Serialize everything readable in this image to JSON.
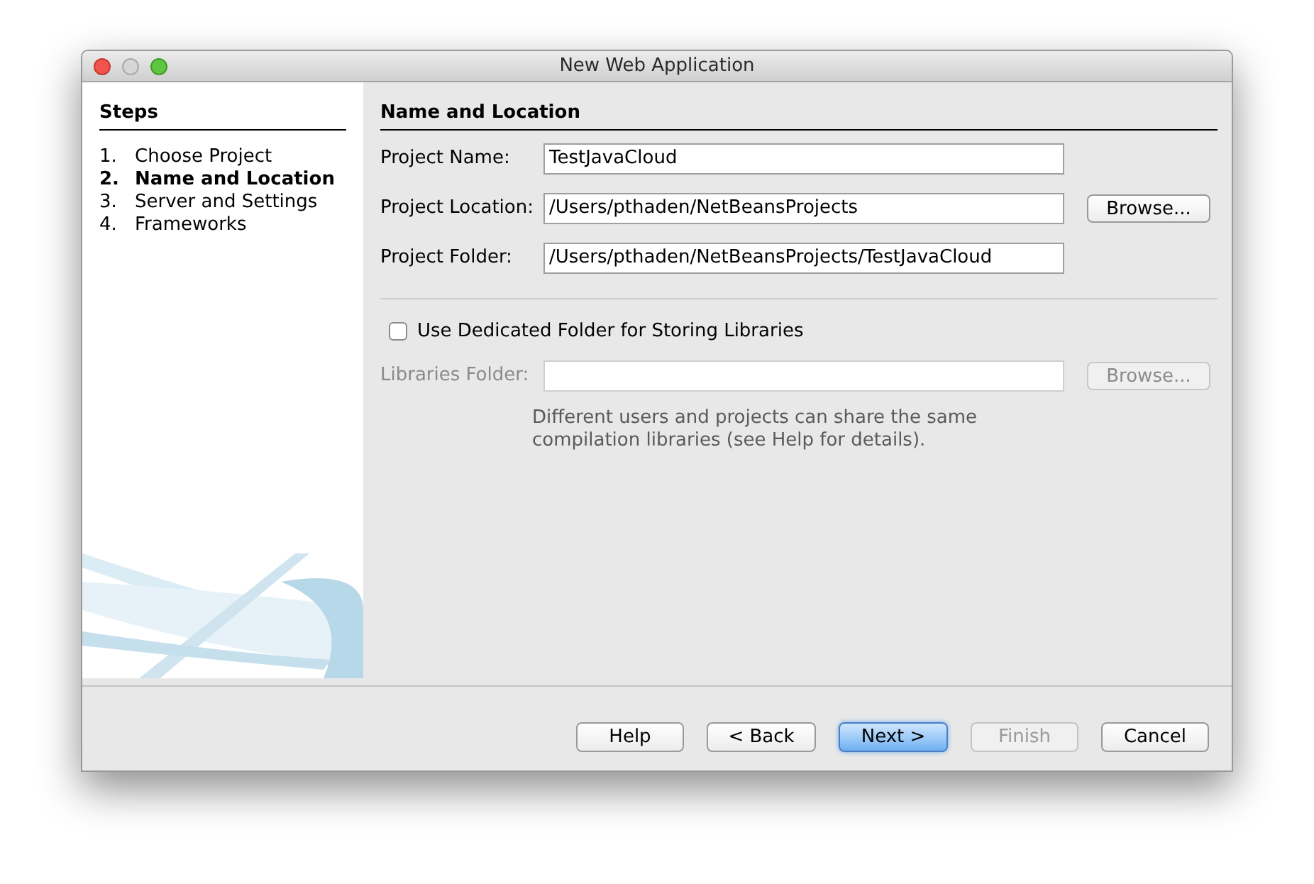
{
  "window": {
    "title": "New Web Application"
  },
  "steps": {
    "title": "Steps",
    "items": [
      {
        "number": "1.",
        "label": "Choose Project",
        "selected": false
      },
      {
        "number": "2.",
        "label": "Name and Location",
        "selected": true
      },
      {
        "number": "3.",
        "label": "Server and Settings",
        "selected": false
      },
      {
        "number": "4.",
        "label": "Frameworks",
        "selected": false
      }
    ]
  },
  "panel": {
    "title": "Name and Location",
    "fields": [
      {
        "label": "Project Name:",
        "value": "TestJavaCloud",
        "disabled": false
      },
      {
        "label": "Project Location:",
        "value": "/Users/pthaden/NetBeansProjects",
        "disabled": false,
        "button": {
          "label": "Browse...",
          "disabled": false
        }
      },
      {
        "label": "Project Folder:",
        "value": "/Users/pthaden/NetBeansProjects/TestJavaCloud",
        "disabled": false
      }
    ],
    "checkbox": {
      "label": "Use Dedicated Folder for Storing Libraries",
      "checked": false
    },
    "libraries": {
      "label": "Libraries Folder:",
      "disabled": true,
      "button": {
        "label": "Browse...",
        "disabled": true
      }
    },
    "note": [
      "Different users and projects can share the same",
      "compilation libraries (see Help for details)."
    ]
  },
  "buttons": [
    {
      "label": "Help",
      "kind": "normal",
      "disabled": false
    },
    {
      "label": "< Back",
      "kind": "normal",
      "disabled": false
    },
    {
      "label": "Next >",
      "kind": "default",
      "disabled": false
    },
    {
      "label": "Finish",
      "kind": "normal",
      "disabled": true
    },
    {
      "label": "Cancel",
      "kind": "normal",
      "disabled": false
    }
  ]
}
